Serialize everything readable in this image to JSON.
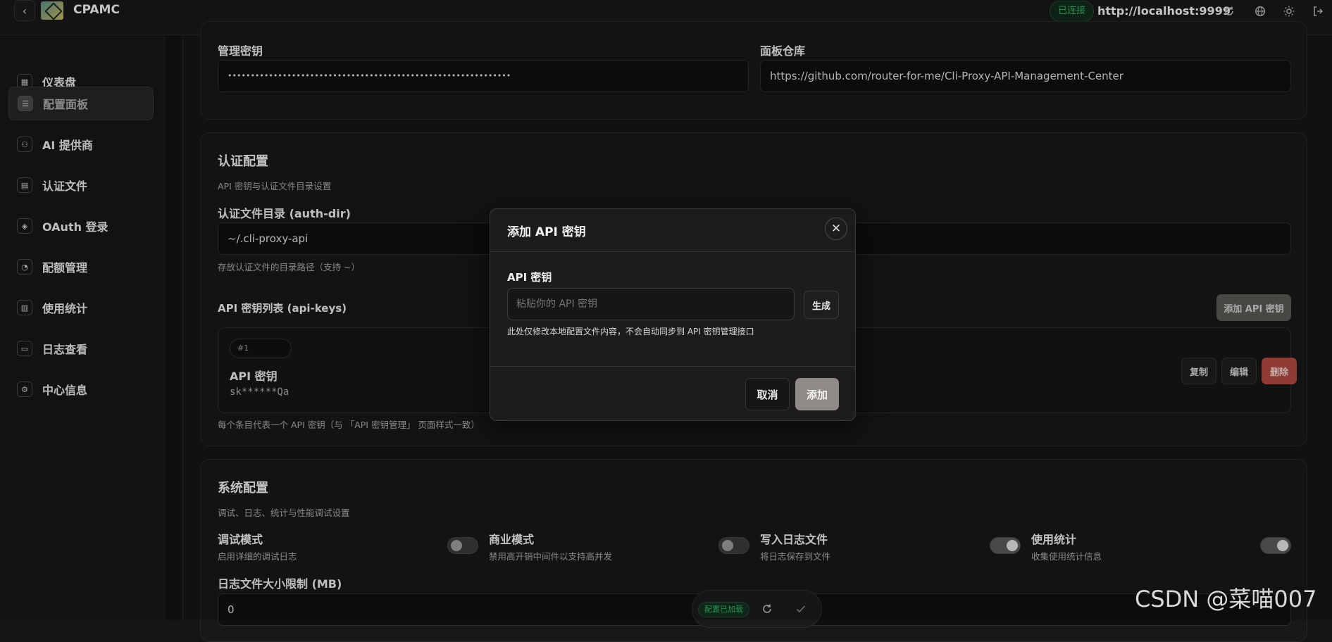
{
  "header": {
    "back_icon": "chevron-left-icon",
    "app_title": "CPAMC",
    "status": "已连接",
    "server_url": "http://localhost:9999",
    "icons": [
      "refresh-icon",
      "globe-icon",
      "sun-icon",
      "logout-icon"
    ]
  },
  "sidebar": {
    "items": [
      {
        "label": "仪表盘",
        "icon": "dashboard-icon"
      },
      {
        "label": "配置面板",
        "icon": "sliders-icon",
        "active": true
      },
      {
        "label": "AI 提供商",
        "icon": "network-icon"
      },
      {
        "label": "认证文件",
        "icon": "file-icon"
      },
      {
        "label": "OAuth 登录",
        "icon": "shield-icon"
      },
      {
        "label": "配额管理",
        "icon": "pie-icon"
      },
      {
        "label": "使用统计",
        "icon": "bar-chart-icon"
      },
      {
        "label": "日志查看",
        "icon": "terminal-icon"
      },
      {
        "label": "中心信息",
        "icon": "cpu-icon"
      }
    ]
  },
  "top_card": {
    "admin_key_label": "管理密钥",
    "admin_key_value": "••••••••••••••••••••••••••••••••••••••••••••••••••••••••••••••",
    "repo_label": "面板仓库",
    "repo_value": "https://github.com/router-for-me/Cli-Proxy-API-Management-Center"
  },
  "auth_card": {
    "title": "认证配置",
    "desc": "API 密钥与认证文件目录设置",
    "auth_dir_label": "认证文件目录 (auth-dir)",
    "auth_dir_value": "~/.cli-proxy-api",
    "auth_dir_hint": "存放认证文件的目录路径（支持 ~）",
    "api_keys_label": "API 密钥列表 (api-keys)",
    "add_key_button": "添加 API 密钥",
    "key_item": {
      "index": "#1",
      "title": "API 密钥",
      "value": "sk******Qa"
    },
    "copy_button": "复制",
    "edit_button": "编辑",
    "delete_button": "删除",
    "footer_hint": "每个条目代表一个 API 密钥（与 「API 密钥管理」 页面样式一致）"
  },
  "system_card": {
    "title": "系统配置",
    "desc": "调试、日志、统计与性能调试设置",
    "settings": [
      {
        "title": "调试模式",
        "desc": "启用详细的调试日志",
        "on": false
      },
      {
        "title": "商业模式",
        "desc": "禁用高开销中间件以支持高并发",
        "on": false
      },
      {
        "title": "写入日志文件",
        "desc": "将日志保存到文件",
        "on": true
      },
      {
        "title": "使用统计",
        "desc": "收集使用统计信息",
        "on": true
      }
    ],
    "log_size_label": "日志文件大小限制 (MB)",
    "log_size_value": "0"
  },
  "modal": {
    "title": "添加 API 密钥",
    "field_label": "API 密钥",
    "placeholder": "粘贴你的 API 密钥",
    "generate_button": "生成",
    "hint": "此处仅修改本地配置文件内容，不会自动同步到 API 密钥管理接口",
    "cancel_button": "取消",
    "add_button": "添加"
  },
  "float_bar": {
    "status": "配置已加载",
    "reload_icon": "refresh-icon",
    "save_icon": "check-icon"
  },
  "watermark": "CSDN @菜喵007",
  "colors": {
    "background": "#151515",
    "connected": "#2fb463",
    "delete": "#b04a40",
    "add_button": "#8f8a86"
  }
}
